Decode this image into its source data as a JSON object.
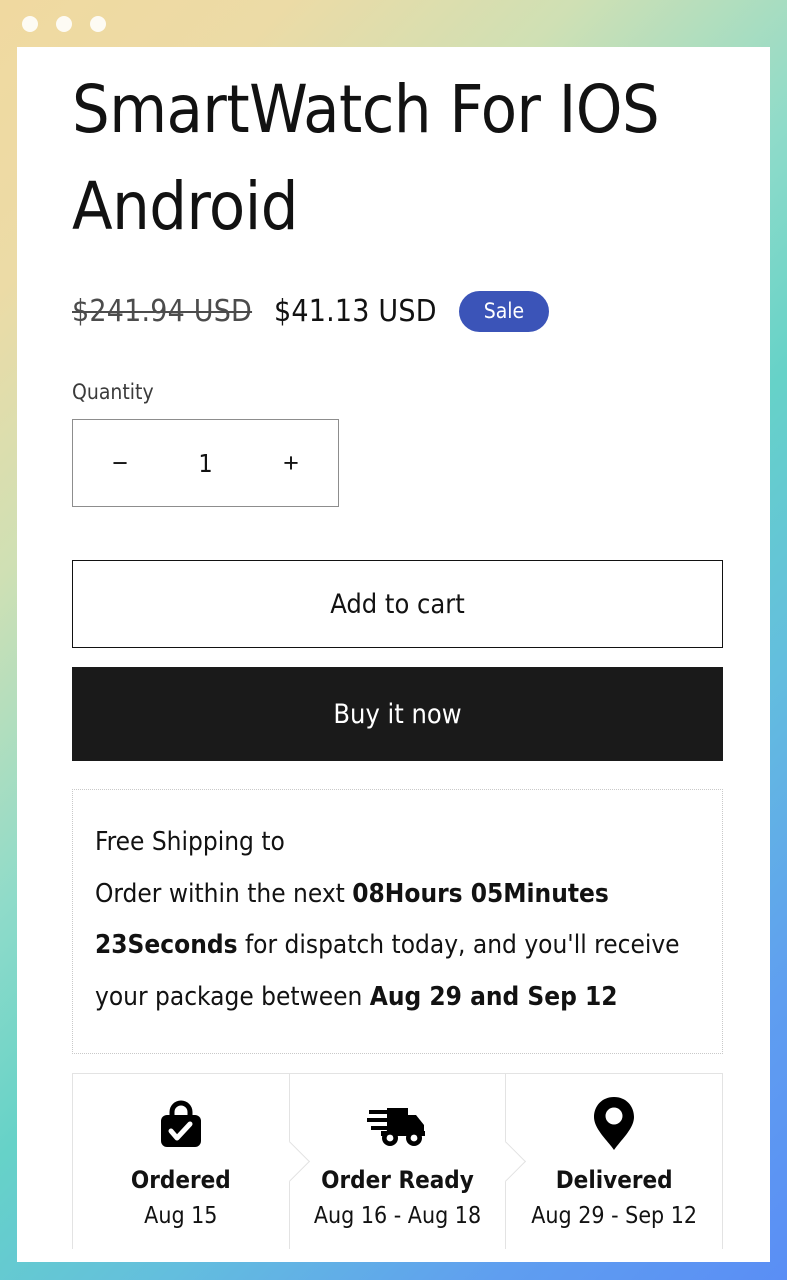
{
  "window": {
    "dots": [
      "window-dot-1",
      "window-dot-2",
      "window-dot-3"
    ],
    "gradient_start": "#f0d9a0",
    "gradient_mid": "#66d2c8",
    "gradient_end": "#5a8ef5"
  },
  "product": {
    "title": "SmartWatch For IOS Android",
    "price_compare": "$241.94 USD",
    "price_current": "$41.13 USD",
    "sale_badge": "Sale",
    "sale_badge_color": "#3b54b8"
  },
  "quantity": {
    "label": "Quantity",
    "decrease_symbol": "−",
    "value": "1",
    "increase_symbol": "+"
  },
  "actions": {
    "add_to_cart": "Add to cart",
    "buy_it_now": "Buy it now"
  },
  "shipping": {
    "heading": "Free Shipping to",
    "line_prefix": "Order within the next ",
    "countdown": "08Hours 05Minutes 23Seconds",
    "line_middle": " for dispatch today, and you'll receive your package between ",
    "delivery_range": "Aug 29 and Sep 12"
  },
  "steps": [
    {
      "icon": "shopping-bag-check-icon",
      "label": "Ordered",
      "date": "Aug 15"
    },
    {
      "icon": "delivery-truck-icon",
      "label": "Order Ready",
      "date": "Aug 16 - Aug 18"
    },
    {
      "icon": "location-pin-icon",
      "label": "Delivered",
      "date": "Aug 29 - Sep 12"
    }
  ]
}
